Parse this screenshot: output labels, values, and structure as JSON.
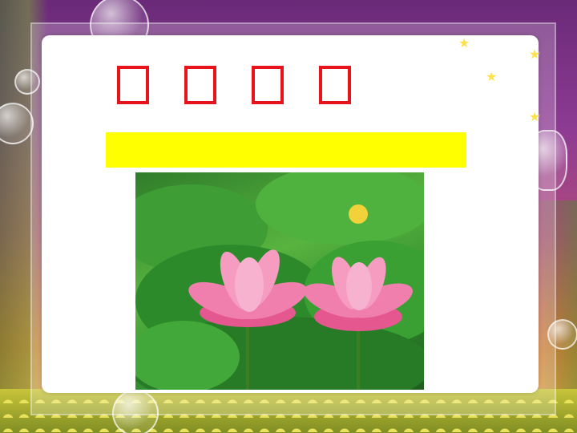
{
  "slide": {
    "title_chars": [
      "",
      "",
      "",
      ""
    ],
    "subtitle": "",
    "photo": {
      "alt": ""
    }
  },
  "decor": {
    "star_glyph": "★"
  },
  "colors": {
    "title": "#e8141c",
    "subtitle_bg": "#ffff00",
    "panel": "#ffffff"
  }
}
